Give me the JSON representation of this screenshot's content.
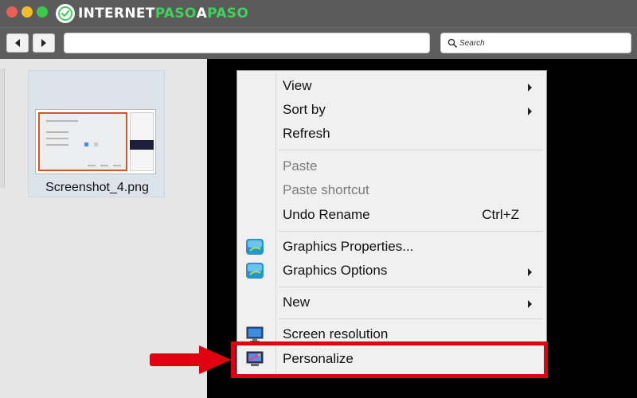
{
  "branding": {
    "logo_white_1": "INTERNET",
    "logo_green": "PASO",
    "logo_white_2": "A",
    "logo_green_2": "PASO"
  },
  "toolbar": {
    "back_icon": "back-arrow-icon",
    "forward_icon": "forward-arrow-icon",
    "address_value": "",
    "search_placeholder": "Search"
  },
  "explorer": {
    "file": {
      "name": "Screenshot_4.png"
    }
  },
  "context_menu": {
    "items": [
      {
        "label": "View",
        "submenu": true,
        "enabled": true
      },
      {
        "label": "Sort by",
        "submenu": true,
        "enabled": true
      },
      {
        "label": "Refresh",
        "submenu": false,
        "enabled": true
      },
      {
        "label": "Paste",
        "submenu": false,
        "enabled": false
      },
      {
        "label": "Paste shortcut",
        "submenu": false,
        "enabled": false
      },
      {
        "label": "Undo Rename",
        "shortcut": "Ctrl+Z",
        "submenu": false,
        "enabled": true
      },
      {
        "label": "Graphics Properties...",
        "submenu": false,
        "enabled": true,
        "icon": "intel-graphics-icon"
      },
      {
        "label": "Graphics Options",
        "submenu": true,
        "enabled": true,
        "icon": "intel-graphics-icon"
      },
      {
        "label": "New",
        "submenu": true,
        "enabled": true
      },
      {
        "label": "Screen resolution",
        "submenu": false,
        "enabled": true,
        "icon": "display-icon"
      },
      {
        "label": "Personalize",
        "submenu": false,
        "enabled": true,
        "icon": "personalize-icon",
        "highlighted": true
      }
    ]
  },
  "colors": {
    "highlight": "#e10010",
    "desktop": "#000000",
    "menu_bg": "#f0f0f0",
    "brand_green": "#41d15a"
  }
}
